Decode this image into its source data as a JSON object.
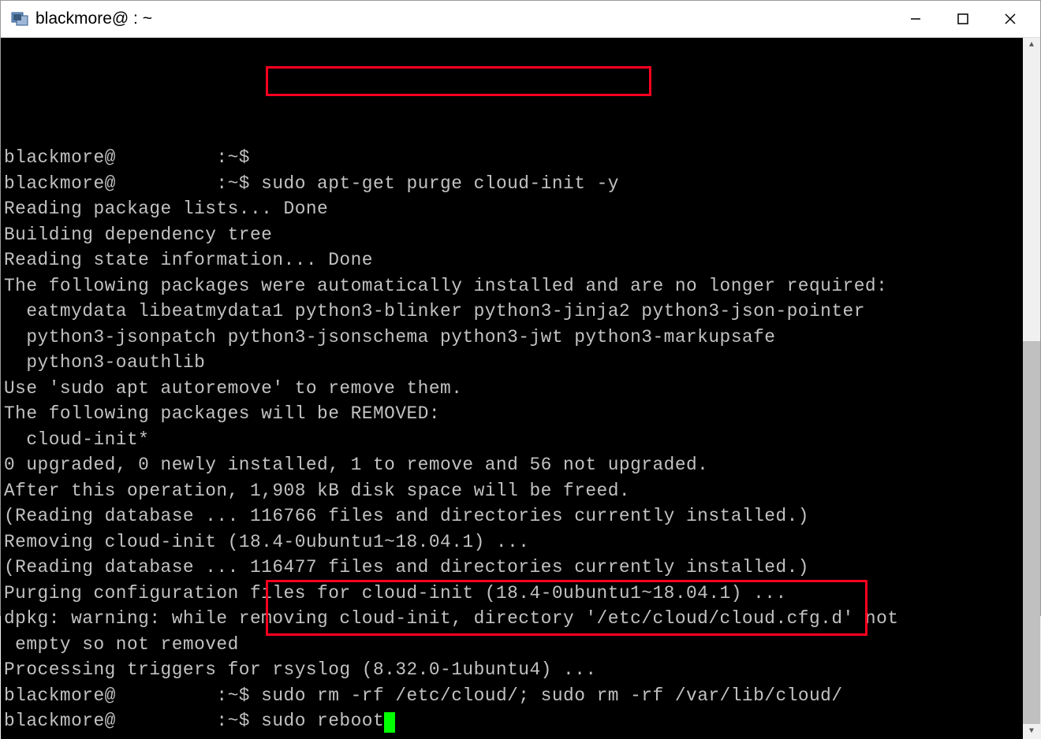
{
  "window": {
    "title": "blackmore@         : ~"
  },
  "terminal": {
    "lines": [
      {
        "prompt": "blackmore@         :~$",
        "cmd": ""
      },
      {
        "prompt": "blackmore@         :~$ ",
        "cmd": "sudo apt-get purge cloud-init -y"
      },
      {
        "text": "Reading package lists... Done"
      },
      {
        "text": "Building dependency tree"
      },
      {
        "text": "Reading state information... Done"
      },
      {
        "text": "The following packages were automatically installed and are no longer required:"
      },
      {
        "text": "  eatmydata libeatmydata1 python3-blinker python3-jinja2 python3-json-pointer"
      },
      {
        "text": "  python3-jsonpatch python3-jsonschema python3-jwt python3-markupsafe"
      },
      {
        "text": "  python3-oauthlib"
      },
      {
        "text": "Use 'sudo apt autoremove' to remove them."
      },
      {
        "text": "The following packages will be REMOVED:"
      },
      {
        "text": "  cloud-init*"
      },
      {
        "text": "0 upgraded, 0 newly installed, 1 to remove and 56 not upgraded."
      },
      {
        "text": "After this operation, 1,908 kB disk space will be freed."
      },
      {
        "text": "(Reading database ... 116766 files and directories currently installed.)"
      },
      {
        "text": "Removing cloud-init (18.4-0ubuntu1~18.04.1) ..."
      },
      {
        "text": "(Reading database ... 116477 files and directories currently installed.)"
      },
      {
        "text": "Purging configuration files for cloud-init (18.4-0ubuntu1~18.04.1) ..."
      },
      {
        "text": "dpkg: warning: while removing cloud-init, directory '/etc/cloud/cloud.cfg.d' not"
      },
      {
        "text": " empty so not removed"
      },
      {
        "text": "Processing triggers for rsyslog (8.32.0-1ubuntu4) ..."
      },
      {
        "prompt": "blackmore@         :~$ ",
        "cmd": "sudo rm -rf /etc/cloud/; sudo rm -rf /var/lib/cloud/"
      },
      {
        "prompt": "blackmore@         :~$ ",
        "cmd": "sudo reboot",
        "cursor": true
      }
    ]
  }
}
